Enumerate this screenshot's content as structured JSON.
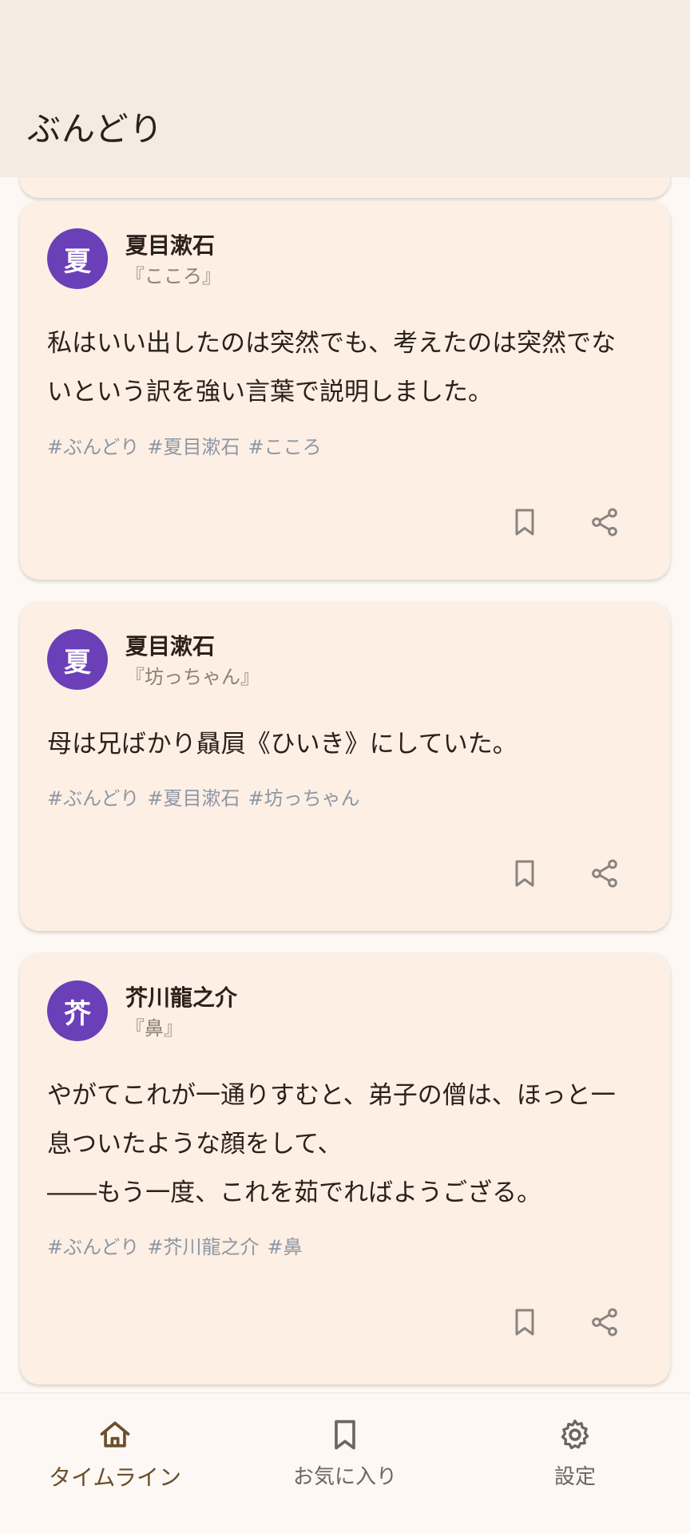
{
  "app": {
    "title": "ぶんどり"
  },
  "cards": [
    {
      "avatar": "夏",
      "author": "夏目漱石",
      "work": "『こころ』",
      "quote": "私はいい出したのは突然でも、考えたのは突然でないという訳を強い言葉で説明しました。",
      "tags": [
        "#ぶんどり",
        "#夏目漱石",
        "#こころ"
      ]
    },
    {
      "avatar": "夏",
      "author": "夏目漱石",
      "work": "『坊っちゃん』",
      "quote": "母は兄ばかり贔屓《ひいき》にしていた。",
      "tags": [
        "#ぶんどり",
        "#夏目漱石",
        "#坊っちゃん"
      ]
    },
    {
      "avatar": "芥",
      "author": "芥川龍之介",
      "work": "『鼻』",
      "quote": "やがてこれが一通りすむと、弟子の僧は、ほっと一息ついたような顔をして、\n――もう一度、これを茹でればようござる。",
      "tags": [
        "#ぶんどり",
        "#芥川龍之介",
        "#鼻"
      ]
    }
  ],
  "nav": {
    "timeline": "タイムライン",
    "favorites": "お気に入り",
    "settings": "設定"
  },
  "colors": {
    "accent": "#6B3FB7",
    "card": "#FDEFE4",
    "appbar": "#F4ECE2",
    "tag": "#8D97A4"
  }
}
